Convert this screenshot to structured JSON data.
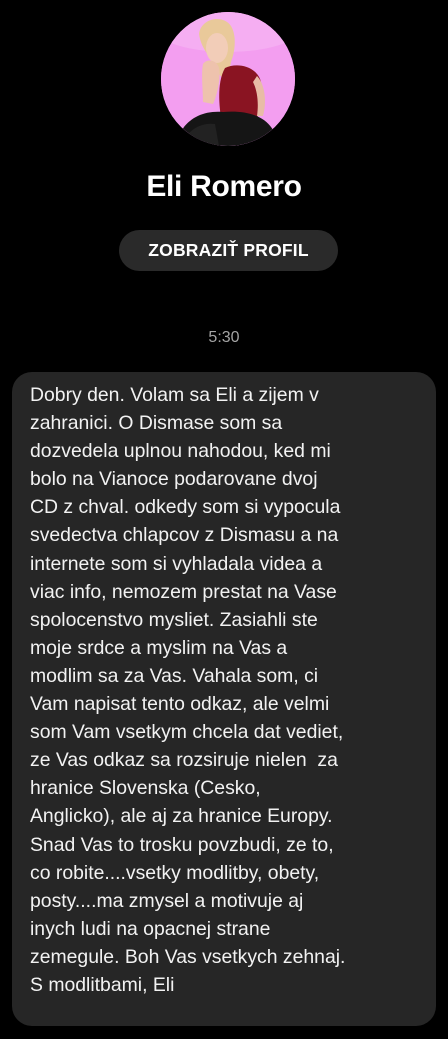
{
  "profile": {
    "name": "Eli Romero",
    "view_profile_label": "ZOBRAZIŤ PROFIL",
    "avatar_icon": "profile-photo"
  },
  "conversation": {
    "timestamp": "5:30",
    "message_text": "Dobry den. Volam sa Eli a zijem v\nzahranici. O Dismase som sa\ndozvedela uplnou nahodou, ked mi\nbolo na Vianoce podarovane dvoj\nCD z chval. odkedy som si vypocula\nsvedectva chlapcov z Dismasu a na\ninternete som si vyhladala videa a\nviac info, nemozem prestat na Vase\nspolocenstvo mysliet. Zasiahli ste\nmoje srdce a myslim na Vas a\nmodlim sa za Vas. Vahala som, ci\nVam napisat tento odkaz, ale velmi\nsom Vam vsetkym chcela dat vediet,\nze Vas odkaz sa rozsiruje nielen  za\nhranice Slovenska (Cesko,\nAnglicko), ale aj za hranice Europy.\nSnad Vas to trosku povzbudi, ze to,\nco robite....vsetky modlitby, obety,\nposty....ma zmysel a motivuje aj\ninych ludi na opacnej strane\nzemegule. Boh Vas vsetkych zehnaj.\nS modlitbami, Eli"
  },
  "colors": {
    "background": "#000000",
    "avatar_background": "#f39ef0",
    "button_background": "#2a2a2a",
    "bubble_background": "#262626",
    "timestamp_text": "#a3a3a3"
  }
}
